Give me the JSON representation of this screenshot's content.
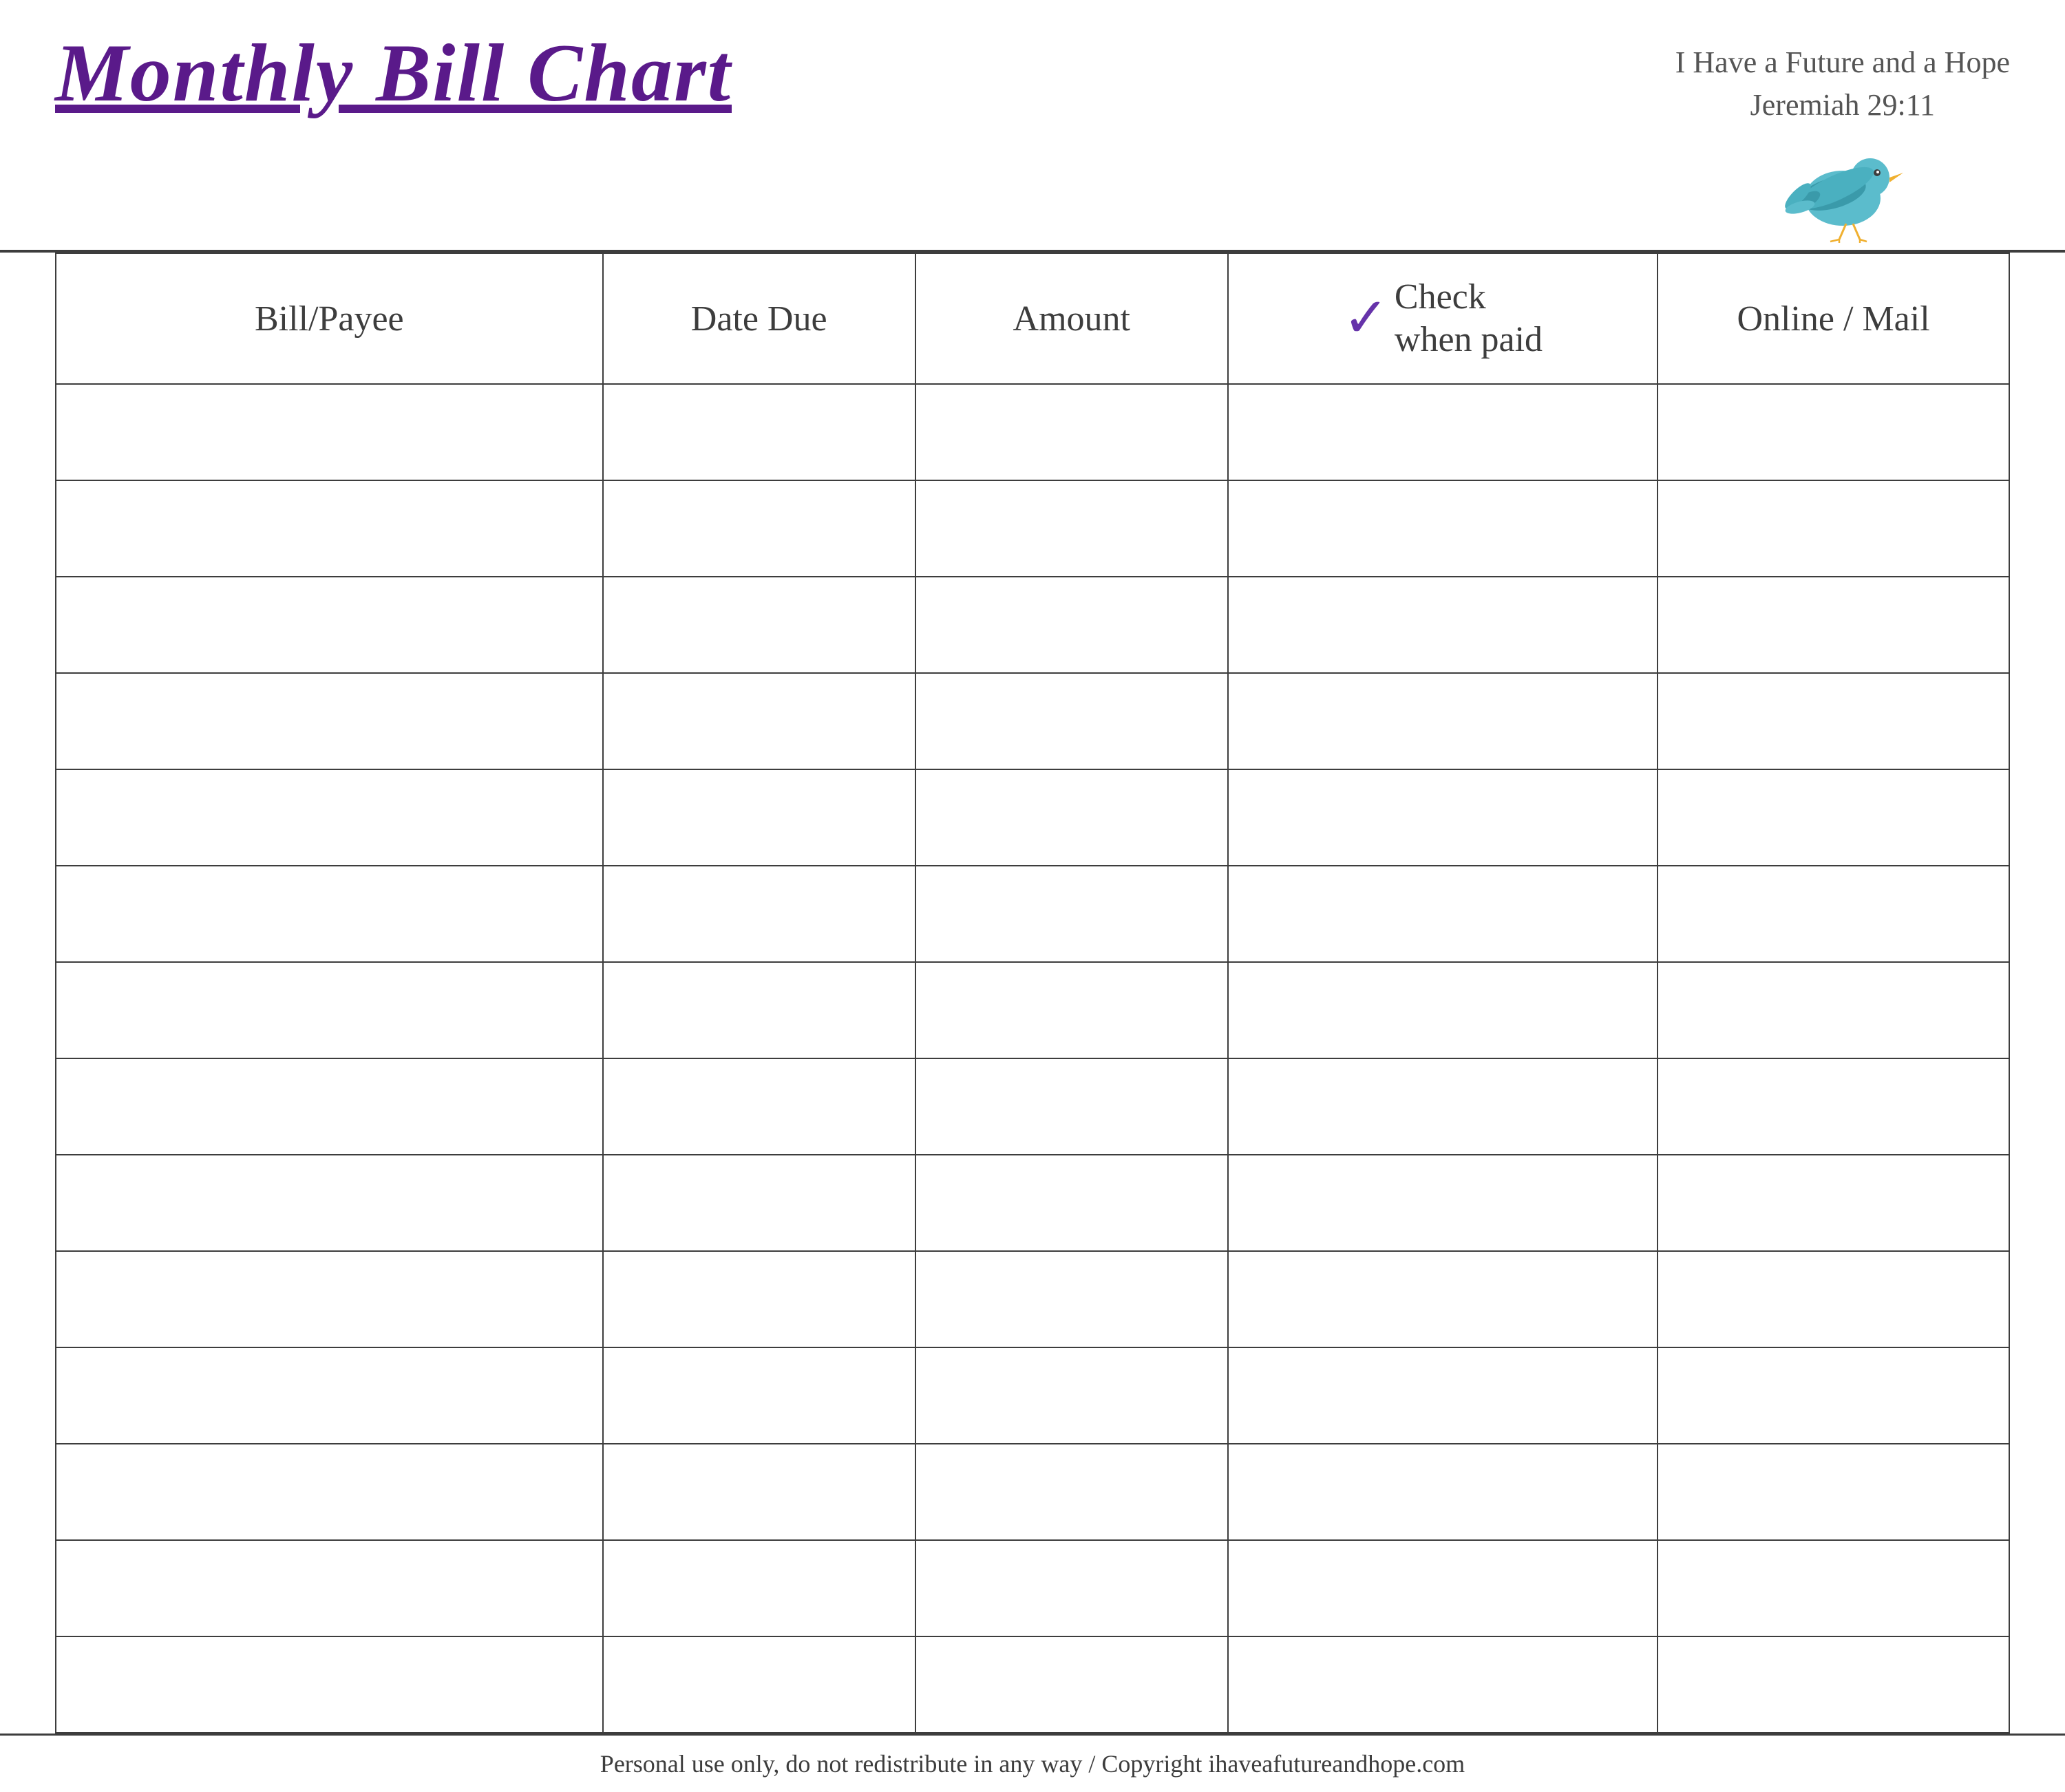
{
  "header": {
    "title": "Monthly Bill Chart",
    "scripture_line1": "I Have a Future and a Hope",
    "scripture_line2": "Jeremiah 29:11"
  },
  "table": {
    "columns": [
      {
        "id": "bill",
        "label": "Bill/Payee"
      },
      {
        "id": "date",
        "label": "Date Due"
      },
      {
        "id": "amount",
        "label": "Amount"
      },
      {
        "id": "check",
        "label_check": "Check",
        "label_when": "when paid"
      },
      {
        "id": "online",
        "label": "Online / Mail"
      }
    ],
    "row_count": 14
  },
  "footer": {
    "text": "Personal use only, do not redistribute in any way / Copyright ihaveafutureandhope.com"
  },
  "colors": {
    "title": "#5a1a8a",
    "border": "#3d3d3d",
    "checkmark": "#6633aa",
    "text": "#3d3d3d",
    "scripture": "#555555",
    "bird_body": "#5bbccc",
    "bird_wing": "#3a9aaa",
    "bird_beak": "#f0b030",
    "bird_eye": "#3d3d3d"
  }
}
